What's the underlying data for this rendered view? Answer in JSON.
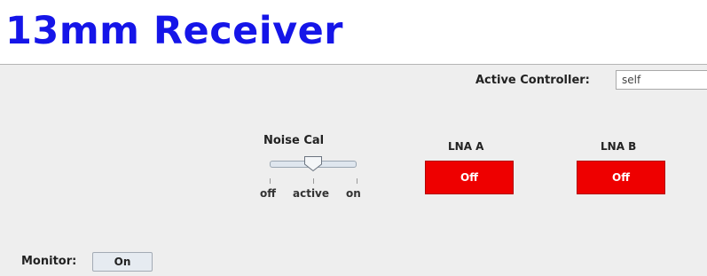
{
  "header": {
    "title": "13mm Receiver"
  },
  "active_controller": {
    "label": "Active Controller:",
    "value": "self"
  },
  "noise_cal": {
    "title": "Noise Cal",
    "options": [
      "off",
      "active",
      "on"
    ],
    "selected": "active"
  },
  "lna_a": {
    "label": "LNA A",
    "button_label": "Off"
  },
  "lna_b": {
    "label": "LNA B",
    "button_label": "Off"
  },
  "monitor": {
    "label": "Monitor:",
    "button_label": "On"
  },
  "colors": {
    "title": "#1515e8",
    "off_button": "#ee0000",
    "background": "#eeeeee"
  }
}
